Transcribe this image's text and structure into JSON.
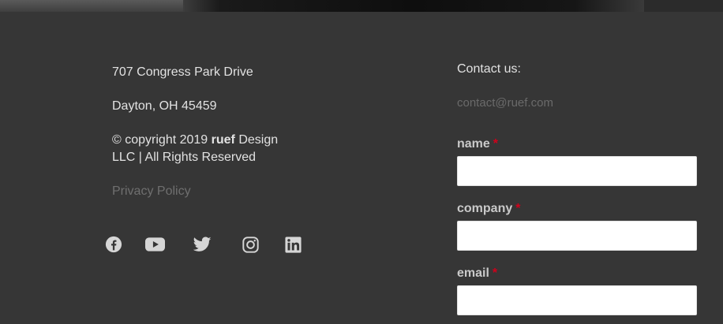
{
  "address": {
    "line1": "707 Congress Park Drive",
    "line2": "Dayton, OH 45459",
    "copyright_prefix": "© copyright 2019 ",
    "copyright_brand": "ruef",
    "copyright_suffix": " Design LLC | All Rights Reserved",
    "privacy_link": "Privacy Policy"
  },
  "social": [
    {
      "name": "facebook-icon"
    },
    {
      "name": "youtube-icon"
    },
    {
      "name": "twitter-icon"
    },
    {
      "name": "instagram-icon"
    },
    {
      "name": "linkedin-icon"
    }
  ],
  "contact": {
    "title": "Contact us:",
    "email": "contact@ruef.com",
    "fields": [
      {
        "label": "name",
        "required_mark": "*",
        "value": "",
        "placeholder": ""
      },
      {
        "label": "company",
        "required_mark": "*",
        "value": "",
        "placeholder": ""
      },
      {
        "label": "email",
        "required_mark": "*",
        "value": "",
        "placeholder": ""
      }
    ]
  },
  "colors": {
    "background": "#363636",
    "text": "#e2e2e2",
    "muted": "#6f6f6f",
    "required": "#d0011b"
  }
}
